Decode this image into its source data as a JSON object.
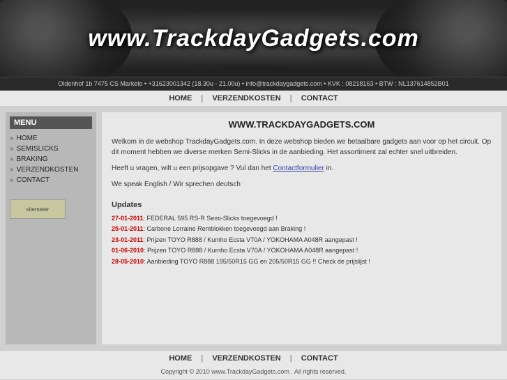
{
  "header": {
    "title": "www.TrackdayGadgets.com"
  },
  "infobar": {
    "text": "Oldenhof 1b 7475 CS Markelo  •  +31623001342 (18.30u - 21.00u)  •  info@trackdaygadgets.com  •  KVK : 08218163  •  BTW : NL137614852B01"
  },
  "nav": {
    "items": [
      {
        "label": "HOME",
        "id": "nav-home"
      },
      {
        "label": "VERZENDKOSTEN",
        "id": "nav-verzendkosten"
      },
      {
        "label": "CONTACT",
        "id": "nav-contact"
      }
    ],
    "separator": "|"
  },
  "sidebar": {
    "title": "MENU",
    "items": [
      {
        "label": "HOME"
      },
      {
        "label": "SEMISLICKS"
      },
      {
        "label": "BRAKING"
      },
      {
        "label": "VERZENDKOSTEN"
      },
      {
        "label": "CONTACT"
      }
    ],
    "logo_text": "sitemeter"
  },
  "content": {
    "title": "WWW.TRACKDAYGADGETS.COM",
    "para1": "Welkom in de webshop TrackdayGadgets.com. In deze webshop bieden we betaalbare gadgets aan voor op het circuit. Op dit moment hebben we diverse merken Semi-Slicks in de aanbieding. Het assortiment zal echter snel uitbreiden.",
    "para2_prefix": "Heeft u vragen, wilt u een prijsopgave ? Vul dan het ",
    "para2_link": "Contactformulier",
    "para2_suffix": " in.",
    "para3": "We speak English / Wir sprechen deutsch",
    "updates_title": "Updates",
    "updates": [
      {
        "date": "27-01-2011",
        "text": ": FEDERAL 595 RS-R Semi-Slicks toegevoegd !"
      },
      {
        "date": "25-01-2011",
        "text": ": Carbone Lorraine Remblokken toegevoegd aan Braking !"
      },
      {
        "date": "23-01-2011",
        "text": ": Prijzen TOYO R888 / Kumho Ecsta V70A / YOKOHAMA A048R aangepast !"
      },
      {
        "date": "01-06-2010",
        "text": ": Prijzen TOYO R888 / Kumho Ecsta V70A / YOKOHAMA A048R aangepast !"
      },
      {
        "date": "28-05-2010",
        "text": ": Aanbieding TOYO R888 195/50R15 GG en 205/50R15 GG !! Check de prijslijst !"
      }
    ]
  },
  "footer": {
    "nav_items": [
      {
        "label": "HOME"
      },
      {
        "label": "VERZENDKOSTEN"
      },
      {
        "label": "CONTACT"
      }
    ],
    "separator": "|",
    "copyright": "Copyright © 2010 www.TrackdayGadgets.com . All rights reserved."
  }
}
